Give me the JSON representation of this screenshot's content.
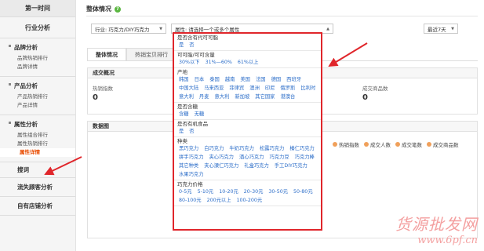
{
  "sidebar": {
    "top": "第一时间",
    "industry": "行业分析",
    "brand": {
      "title": "品牌分析",
      "items": [
        "品牌热销排行",
        "品牌详情"
      ]
    },
    "product": {
      "title": "产品分析",
      "items": [
        "产品热销排行",
        "产品详情"
      ]
    },
    "attribute": {
      "title": "属性分析",
      "items": [
        "属性组合排行",
        "属性热销排行",
        "属性详情"
      ]
    },
    "keywords": "搜词",
    "customer": "流失顾客分析",
    "own_store": "自有店铺分析"
  },
  "header": {
    "title": "整体情况",
    "help": "?"
  },
  "filters": {
    "industry": "行业: 巧克力/DIY巧克力",
    "attribute_placeholder": "属性: 请选择一个或多个属性",
    "period": "最近7天"
  },
  "tabs": [
    "整体情况",
    "热销宝贝排行"
  ],
  "summary": {
    "title": "成交概况",
    "metrics": [
      {
        "label": "热销指数",
        "value": "0"
      },
      {
        "label": "成交商品数",
        "value": "0"
      }
    ]
  },
  "data_chart": {
    "title": "数据图",
    "legend": [
      "热销指数",
      "成交人数",
      "成交笔数",
      "成交商品数"
    ]
  },
  "dropdown": {
    "groups": [
      {
        "title": "是否含有代可可脂",
        "options": [
          "是",
          "否"
        ]
      },
      {
        "title": "可可脂/可可含量",
        "options": [
          "30%以下",
          "31%—60%",
          "61%以上"
        ]
      },
      {
        "title": "产地",
        "options": [
          "韩国",
          "日本",
          "泰国",
          "越南",
          "美国",
          "法国",
          "德国",
          "西班牙",
          "中国大陆",
          "马来西亚",
          "菲律宾",
          "澳洲",
          "印尼",
          "俄罗斯",
          "比利时",
          "意大利",
          "丹麦",
          "意大利",
          "新加坡",
          "其它国家",
          "港澳台"
        ]
      },
      {
        "title": "是否含糖",
        "options": [
          "含糖",
          "无糖"
        ]
      },
      {
        "title": "是否有机食品",
        "options": [
          "是",
          "否"
        ]
      },
      {
        "title": "种类",
        "options": [
          "黑巧克力",
          "白巧克力",
          "牛奶巧克力",
          "松露巧克力",
          "榛仁巧克力",
          "拼手巧克力",
          "夹心巧克力",
          "酒心巧克力",
          "巧克力豆",
          "巧克力棒",
          "其它种类",
          "夹心溧仁巧克力",
          "礼盒巧克力",
          "手工DIY巧克力",
          "水果巧克力"
        ]
      },
      {
        "title": "巧克力价格",
        "options": [
          "0-5元",
          "5-10元",
          "10-20元",
          "20-30元",
          "30-50元",
          "50-80元",
          "80-100元",
          "200元以上",
          "100-200元"
        ]
      }
    ]
  },
  "watermark": {
    "line1": "货源批发网",
    "line2": "www.6pf.cn"
  },
  "colors": {
    "accent_red": "#e0262b",
    "link_blue": "#2a6cc8",
    "active_orange": "#e84b00"
  }
}
